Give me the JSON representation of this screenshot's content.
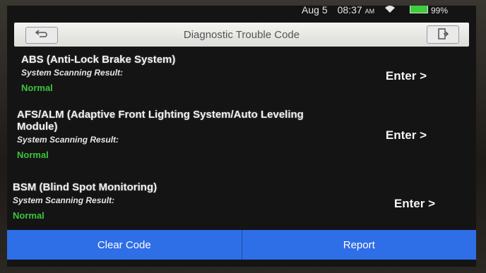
{
  "status": {
    "date": "Aug 5",
    "time": "08:37",
    "ampm": "AM",
    "battery": "99%"
  },
  "header": {
    "title": "Diagnostic Trouble Code"
  },
  "systems": [
    {
      "name": "ABS (Anti-Lock Brake System)",
      "subtitle": "System Scanning Result:",
      "result": "Normal",
      "action": "Enter >"
    },
    {
      "name": "AFS/ALM (Adaptive Front Lighting System/Auto Leveling Module)",
      "subtitle": "System Scanning Result:",
      "result": "Normal",
      "action": "Enter >"
    },
    {
      "name": "BSM (Blind Spot Monitoring)",
      "subtitle": "System Scanning Result:",
      "result": "Normal",
      "action": "Enter >"
    }
  ],
  "footer": {
    "clear_label": "Clear Code",
    "report_label": "Report"
  }
}
